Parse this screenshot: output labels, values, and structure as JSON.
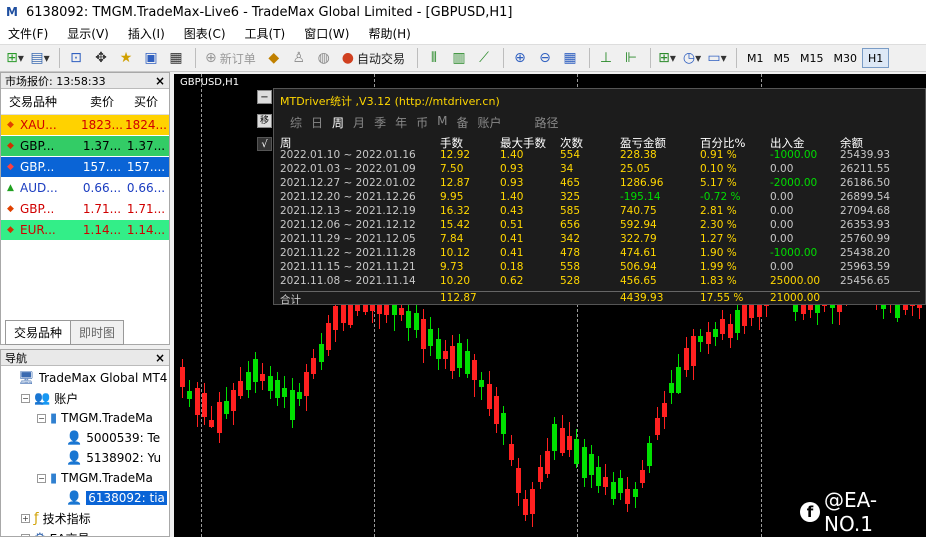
{
  "window": {
    "title": "6138092: TMGM.TradeMax-Live6 - TradeMax Global Limited - [GBPUSD,H1]"
  },
  "menu": [
    "文件(F)",
    "显示(V)",
    "插入(I)",
    "图表(C)",
    "工具(T)",
    "窗口(W)",
    "帮助(H)"
  ],
  "toolbar": {
    "new_order": "新订单",
    "auto_trade": "自动交易",
    "timeframes": [
      "M1",
      "M5",
      "M15",
      "M30",
      "H1"
    ],
    "active_timeframe": "H1"
  },
  "market_watch": {
    "title": "市场报价: 13:58:33",
    "columns": {
      "symbol": "交易品种",
      "bid": "卖价",
      "ask": "买价"
    },
    "rows": [
      {
        "symbol": "XAU...",
        "bid": "1823...",
        "ask": "1824...",
        "bg": "#ffd200",
        "color": "#d00000",
        "dir": "down",
        "arrow_color": "#e04000"
      },
      {
        "symbol": "GBP...",
        "bid": "1.37...",
        "ask": "1.37...",
        "bg": "#33cc66",
        "color": "#000000",
        "dir": "down",
        "arrow_color": "#d03000"
      },
      {
        "symbol": "GBP...",
        "bid": "157....",
        "ask": "157....",
        "bg": "#0a64d6",
        "color": "#ffffff",
        "dir": "down",
        "arrow_color": "#ff4040"
      },
      {
        "symbol": "AUD...",
        "bid": "0.66...",
        "ask": "0.66...",
        "bg": "#ffffff",
        "color": "#1a3cc0",
        "dir": "up",
        "arrow_color": "#20a020"
      },
      {
        "symbol": "GBP...",
        "bid": "1.71...",
        "ask": "1.71...",
        "bg": "#ffffff",
        "color": "#d00000",
        "dir": "down",
        "arrow_color": "#e04000"
      },
      {
        "symbol": "EUR...",
        "bid": "1.14...",
        "ask": "1.14...",
        "bg": "#33ee88",
        "color": "#d00000",
        "dir": "down",
        "arrow_color": "#d03000"
      }
    ],
    "tabs": [
      "交易品种",
      "即时图"
    ]
  },
  "navigator": {
    "title": "导航",
    "items": [
      {
        "label": "TradeMax Global MT4",
        "level": 0,
        "icon": "terminal-icon",
        "glyph": "🖥",
        "exp": ""
      },
      {
        "label": "账户",
        "level": 1,
        "icon": "accounts-icon",
        "glyph": "👥",
        "exp": "−"
      },
      {
        "label": "TMGM.TradeMa",
        "level": 2,
        "icon": "server-icon",
        "glyph": "▮",
        "exp": "−"
      },
      {
        "label": "5000539: Te",
        "level": 3,
        "icon": "account-icon",
        "glyph": "👤",
        "exp": ""
      },
      {
        "label": "5138902: Yu",
        "level": 3,
        "icon": "account-icon",
        "glyph": "👤",
        "exp": ""
      },
      {
        "label": "TMGM.TradeMa",
        "level": 2,
        "icon": "server-icon",
        "glyph": "▮",
        "exp": "−"
      },
      {
        "label": "6138092: tia",
        "level": 3,
        "icon": "account-icon",
        "glyph": "👤",
        "exp": "",
        "selected": true
      },
      {
        "label": "技术指标",
        "level": 1,
        "icon": "indicators-icon",
        "glyph": "ƒ",
        "exp": "+"
      },
      {
        "label": "EA交易",
        "level": 1,
        "icon": "expert-advisors-icon",
        "glyph": "⚙",
        "exp": "+"
      }
    ]
  },
  "chart": {
    "symbol_label": "GBPUSD,H1"
  },
  "stats_panel": {
    "title": "MTDriver统计 ,V3.12 (http://mtdriver.cn)",
    "tabs": [
      "综",
      "日",
      "周",
      "月",
      "季",
      "年",
      "币",
      "M",
      "备",
      "账户",
      "路径"
    ],
    "active_tab": "周",
    "columns": [
      "周",
      "手数",
      "最大手数",
      "次数",
      "盈亏金额",
      "百分比%",
      "出入金",
      "余额"
    ],
    "rows": [
      [
        "2022.01.10 ~ 2022.01.16",
        "12.92",
        "1.40",
        "554",
        "228.38",
        "0.91 %",
        "-1000.00",
        "25439.93"
      ],
      [
        "2022.01.03 ~ 2022.01.09",
        "7.50",
        "0.93",
        "34",
        "25.05",
        "0.10 %",
        "0.00",
        "26211.55"
      ],
      [
        "2021.12.27 ~ 2022.01.02",
        "12.87",
        "0.93",
        "465",
        "1286.96",
        "5.17 %",
        "-2000.00",
        "26186.50"
      ],
      [
        "2021.12.20 ~ 2021.12.26",
        "9.95",
        "1.40",
        "325",
        "-195.14",
        "-0.72 %",
        "0.00",
        "26899.54"
      ],
      [
        "2021.12.13 ~ 2021.12.19",
        "16.32",
        "0.43",
        "585",
        "740.75",
        "2.81 %",
        "0.00",
        "27094.68"
      ],
      [
        "2021.12.06 ~ 2021.12.12",
        "15.42",
        "0.51",
        "656",
        "592.94",
        "2.30 %",
        "0.00",
        "26353.93"
      ],
      [
        "2021.11.29 ~ 2021.12.05",
        "7.84",
        "0.41",
        "342",
        "322.79",
        "1.27 %",
        "0.00",
        "25760.99"
      ],
      [
        "2021.11.22 ~ 2021.11.28",
        "10.12",
        "0.41",
        "478",
        "474.61",
        "1.90 %",
        "-1000.00",
        "25438.20"
      ],
      [
        "2021.11.15 ~ 2021.11.21",
        "9.73",
        "0.18",
        "558",
        "506.94",
        "1.99 %",
        "0.00",
        "25963.59"
      ],
      [
        "2021.11.08 ~ 2021.11.14",
        "10.20",
        "0.62",
        "528",
        "456.65",
        "1.83 %",
        "25000.00",
        "25456.65"
      ]
    ],
    "total": {
      "label": "合计",
      "lots": "112.87",
      "pnl": "4439.93",
      "pct": "17.55 %",
      "deposit": "21000.00"
    }
  },
  "watermark": {
    "text": "@EA-NO.1"
  }
}
